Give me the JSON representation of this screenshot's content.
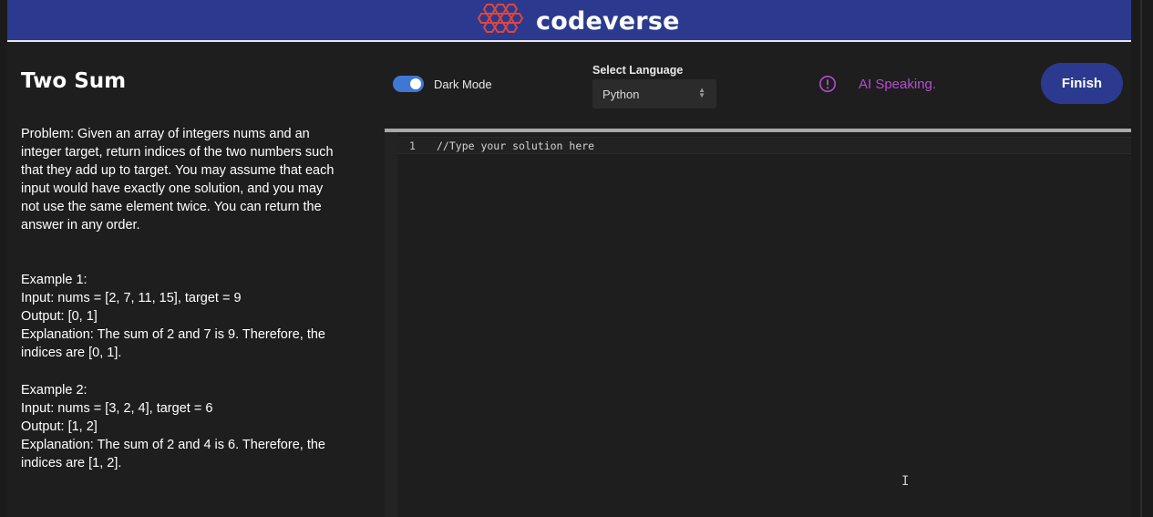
{
  "brand": {
    "name": "codeverse",
    "logo_icon": "honeycomb-logo"
  },
  "problem": {
    "title": "Two Sum",
    "description": "Problem: Given an array of integers nums and an\ninteger target, return indices of the two numbers such\nthat they add up to target. You may assume that each\ninput would have exactly one solution, and you may\nnot use the same element twice. You can return the\nanswer in any order.",
    "examples": [
      {
        "heading": "Example 1:",
        "input": "Input: nums = [2, 7, 11, 15], target = 9",
        "output": "Output: [0, 1]",
        "explanation_1": "Explanation: The sum of 2 and 7 is 9. Therefore, the",
        "explanation_2": "indices are [0, 1]."
      },
      {
        "heading": "Example 2:",
        "input": "Input: nums = [3, 2, 4], target = 6",
        "output": "Output: [1, 2]",
        "explanation_1": "Explanation: The sum of 2 and 4 is 6. Therefore, the",
        "explanation_2": "indices are [1, 2]."
      }
    ]
  },
  "controls": {
    "dark_mode_label": "Dark Mode",
    "dark_mode_on": true,
    "language_label": "Select Language",
    "language_value": "Python",
    "ai_status": "AI Speaking.",
    "ai_status_icon": "alert-circle-icon",
    "finish_label": "Finish"
  },
  "editor": {
    "line_number": "1",
    "code": "//Type your solution here"
  },
  "colors": {
    "header": "#2b3a8f",
    "finish_button": "#2b3a8f",
    "toggle": "#3f78d4",
    "ai_accent": "#b84bd3",
    "background": "#1e1e1e"
  }
}
